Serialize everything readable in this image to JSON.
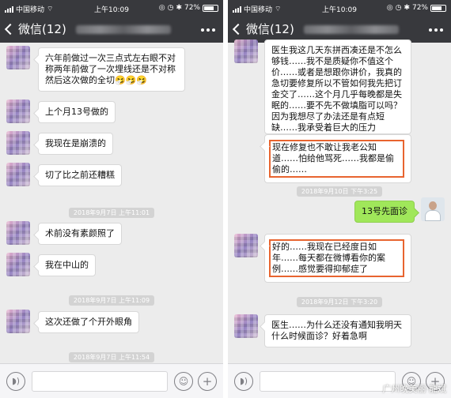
{
  "left": {
    "status": {
      "carrier": "中国移动",
      "time": "上午10:09",
      "battery": "72%",
      "battery_level": 0.72
    },
    "nav": {
      "back_label": "微信(12)"
    },
    "messages": [
      "六年前做过一次三点式左右眼不对称两年前做了一次埋线还是不对称然后这次做的全切🤧🤧🤧",
      "上个月13号做的",
      "我现在是崩溃的",
      "切了比之前还糟糕",
      "术前没有素颜照了",
      "我在中山的",
      "这次还做了个开外眼角"
    ],
    "timestamps": [
      "2018年9月7日 上午11:01",
      "2018年9月7日 上午11:09",
      "2018年9月7日 上午11:54"
    ]
  },
  "right": {
    "status": {
      "carrier": "中国移动",
      "time": "上午10:09",
      "battery": "72%",
      "battery_level": 0.72
    },
    "nav": {
      "back_label": "微信(12)"
    },
    "messages": [
      "医生我这几天东拼西凑还是不怎么够钱……我不是质疑你不值这个价……或者是想跟你讲价，我真的急切要修复所以不管如何我先把订金交了……这个月几乎每晚都是失眠的……要不先不做填脂可以吗？因为我想尽了办法还是有点短缺……我承受着巨大的压力",
      "现在修复也不敢让我老公知道……怕给他骂死……我都是偷偷的……",
      "13号先面诊",
      "好的……我现在已经度日如年……每天都在微博看你的案例……感觉要得抑郁症了",
      "医生……为什么还没有通知我明天什么时候面诊？好着急啊"
    ],
    "timestamps": [
      "2018年9月10日 下午3:25",
      "2018年9月12日 下午3:20"
    ]
  },
  "watermark": "广州晚美丽·龍斌",
  "colors": {
    "nav_bg": "#38393d",
    "chat_bg": "#ececec",
    "bubble_me": "#a0e75a",
    "highlight": "#e8642f"
  }
}
